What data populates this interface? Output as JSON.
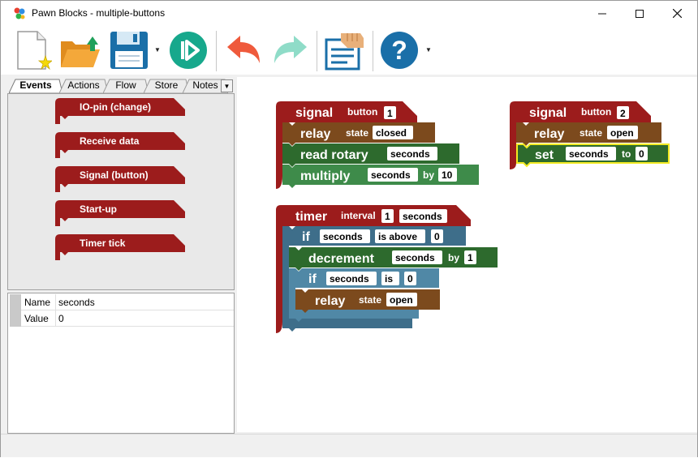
{
  "window": {
    "title": "Pawn Blocks - multiple-buttons",
    "minimize": "—",
    "maximize": "☐",
    "close": "✕"
  },
  "tabs": [
    {
      "label": "Events"
    },
    {
      "label": "Actions"
    },
    {
      "label": "Flow"
    },
    {
      "label": "Store"
    },
    {
      "label": "Notes"
    }
  ],
  "palette": [
    {
      "label": "IO-pin (change)"
    },
    {
      "label": "Receive data"
    },
    {
      "label": "Signal (button)"
    },
    {
      "label": "Start-up"
    },
    {
      "label": "Timer tick"
    }
  ],
  "properties": [
    {
      "name": "Name",
      "value": "seconds"
    },
    {
      "name": "Value",
      "value": "0"
    }
  ],
  "colors": {
    "event": "#9c1c1c",
    "relay": "#7c4a1d",
    "variable": "#2d6a2d",
    "multiply": "#3e8b4a",
    "flow": "#3e6e8a",
    "flow_inner": "#5088a6",
    "selected": "#f2ea22"
  },
  "blocks": {
    "signal1": {
      "word": "signal",
      "param": "button",
      "value": "1",
      "relay": {
        "word": "relay",
        "param": "state",
        "value": "closed"
      },
      "read": {
        "word": "read rotary",
        "value": "seconds"
      },
      "multiply": {
        "word": "multiply",
        "value": "seconds",
        "by": "by",
        "factor": "10"
      }
    },
    "signal2": {
      "word": "signal",
      "param": "button",
      "value": "2",
      "relay": {
        "word": "relay",
        "param": "state",
        "value": "open"
      },
      "set": {
        "word": "set",
        "value": "seconds",
        "to": "to",
        "number": "0"
      }
    },
    "timer": {
      "word": "timer",
      "param": "interval",
      "value": "1",
      "unit": "seconds",
      "if1": {
        "word": "if",
        "value": "seconds",
        "cmp": "is above",
        "number": "0"
      },
      "decrement": {
        "word": "decrement",
        "value": "seconds",
        "by": "by",
        "number": "1"
      },
      "if2": {
        "word": "if",
        "value": "seconds",
        "cmp": "is",
        "number": "0"
      },
      "relay": {
        "word": "relay",
        "param": "state",
        "value": "open"
      }
    }
  }
}
